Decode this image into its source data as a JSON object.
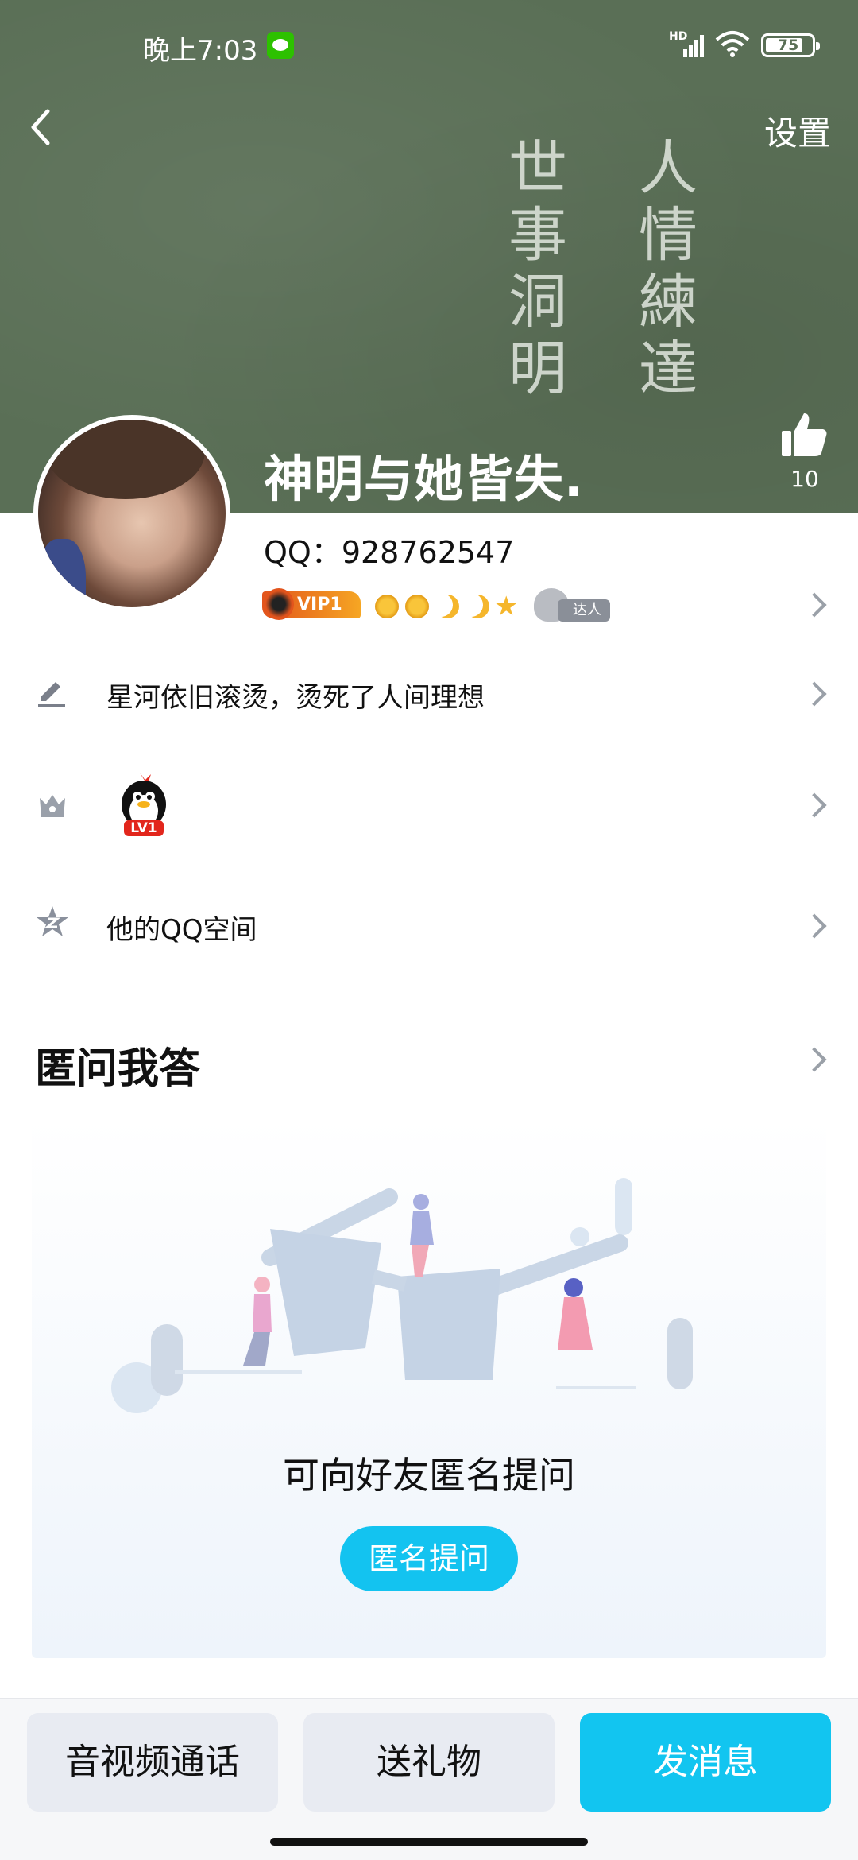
{
  "status_bar": {
    "time": "晚上7:03",
    "network": "HD",
    "battery": "75"
  },
  "header": {
    "settings_label": "设置",
    "cover_text": [
      "人情練達",
      "世事洞明"
    ],
    "nickname": "神明与她皆失.",
    "like_count": "10"
  },
  "profile": {
    "qq": "QQ：928762547",
    "vip_label": "VIP1",
    "daren_label": "达人"
  },
  "rows": [
    {
      "label": "星河依旧滚烫，烫死了人间理想",
      "icon": "pencil-icon"
    },
    {
      "label": "",
      "icon": "crown-icon",
      "badge": "LV1"
    },
    {
      "label": "他的QQ空间",
      "icon": "qzone-star-icon"
    }
  ],
  "qa": {
    "title": "匿问我答",
    "empty_text": "可向好友匿名提问",
    "ask_button": "匿名提问"
  },
  "bottom_bar": {
    "call_label": "音视频通话",
    "gift_label": "送礼物",
    "message_label": "发消息"
  },
  "colors": {
    "accent": "#13c3f0",
    "cover": "#5a6f56"
  }
}
